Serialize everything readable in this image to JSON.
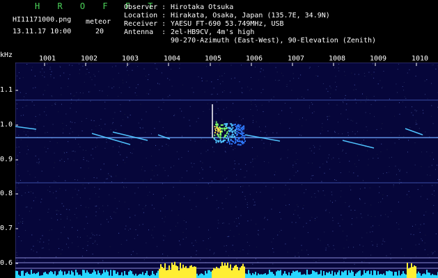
{
  "header": {
    "program": "H R O F F T",
    "filename": "HI11171000.png",
    "datetime": "13.11.17 10:00",
    "meteor_label": "meteor",
    "meteor_count": "20",
    "observer_key": "Observer :",
    "observer_val": "Hirotaka Otsuka",
    "location_key": "Location :",
    "location_val": "Hirakata, Osaka, Japan (135.7E, 34.9N)",
    "receiver_key": "Receiver :",
    "receiver_val": "YAESU FT-690 53.749MHz, USB",
    "antenna_key": "Antenna  :",
    "antenna_val": "2el-HB9CV, 4m's high",
    "antenna_val2": "90-270-Azimuth (East-West), 90-Elevation (Zenith)"
  },
  "axis": {
    "y_unit": "kHz",
    "y_ticks": [
      "1.1",
      "1.0",
      "0.9",
      "0.8",
      "0.7",
      "0.6"
    ],
    "x_ticks": [
      "1001",
      "1002",
      "1003",
      "1004",
      "1005",
      "1006",
      "1007",
      "1008",
      "1009",
      "1010"
    ]
  },
  "colors": {
    "background": "#06063a",
    "trace": "#4fc3ff",
    "echo": "#ffe94a",
    "title": "#4cd45a",
    "level_bar": "#27d6ff",
    "level_peak": "#ffee33"
  }
}
